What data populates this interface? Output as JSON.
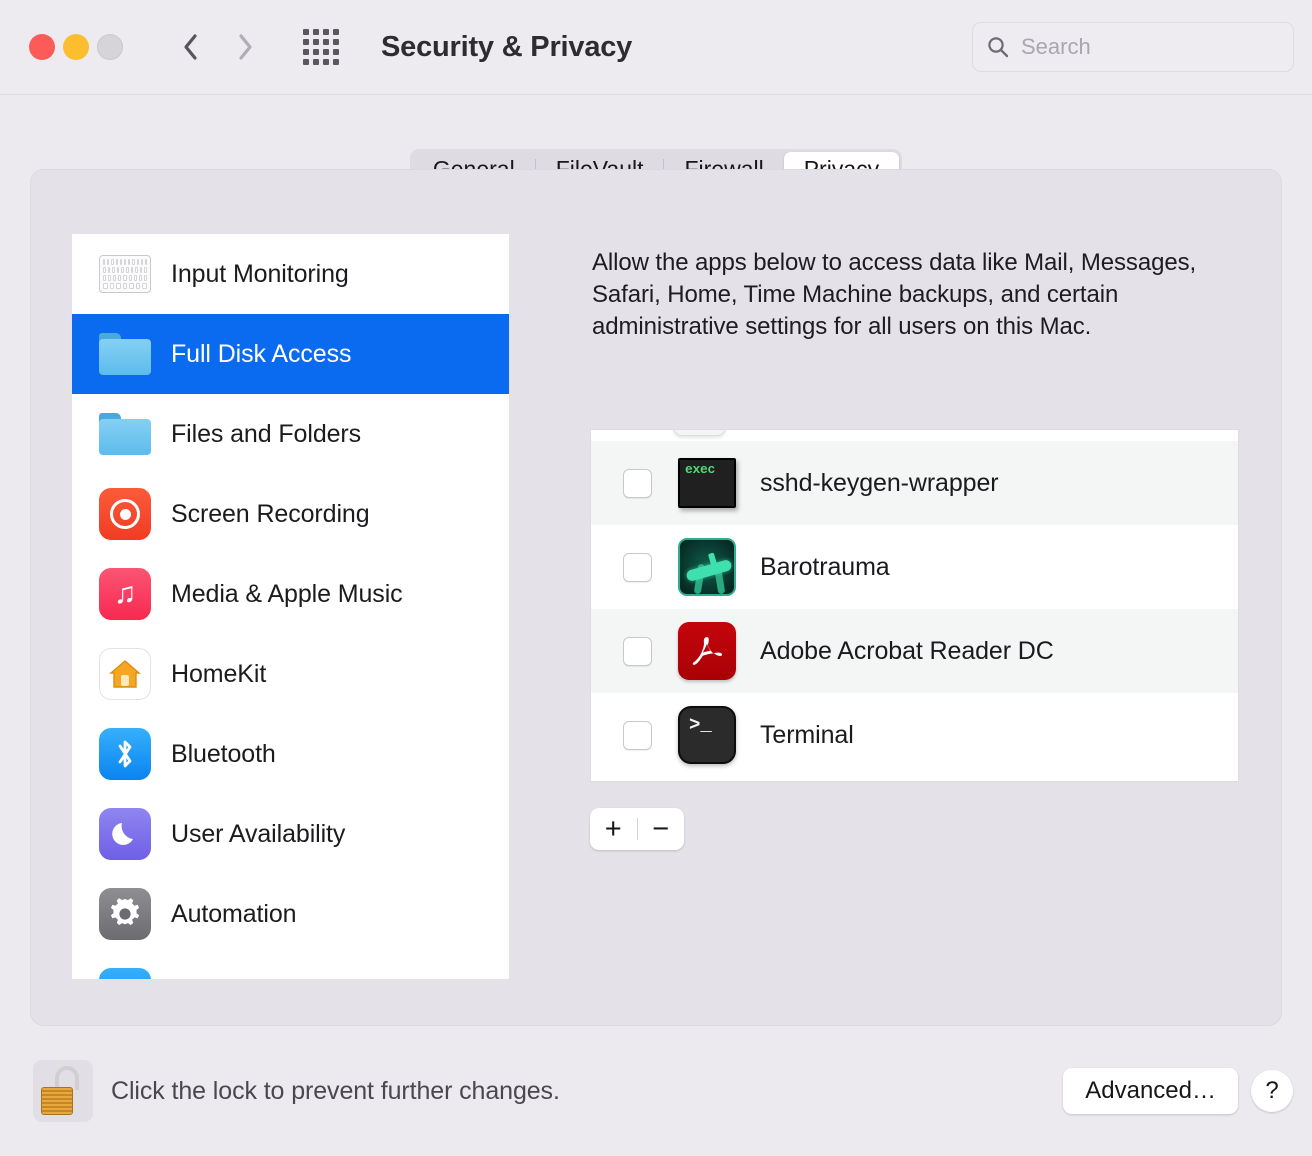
{
  "window": {
    "title": "Security & Privacy",
    "traffic_lights": [
      "close",
      "minimize",
      "zoom"
    ],
    "nav": {
      "back_icon": "chevron-left-icon",
      "forward_icon": "chevron-right-icon",
      "grid_icon": "grid-apps-icon"
    }
  },
  "search": {
    "placeholder": "Search",
    "value": "",
    "icon": "search-icon"
  },
  "tabs": [
    {
      "label": "General",
      "active": false
    },
    {
      "label": "FileVault",
      "active": false
    },
    {
      "label": "Firewall",
      "active": false
    },
    {
      "label": "Privacy",
      "active": true
    }
  ],
  "sidebar": {
    "items": [
      {
        "label": "Input Monitoring",
        "icon": "keyboard-icon",
        "selected": false
      },
      {
        "label": "Full Disk Access",
        "icon": "folder-icon",
        "selected": true
      },
      {
        "label": "Files and Folders",
        "icon": "folder-icon",
        "selected": false
      },
      {
        "label": "Screen Recording",
        "icon": "screen-recording-icon",
        "selected": false
      },
      {
        "label": "Media & Apple Music",
        "icon": "music-note-icon",
        "selected": false
      },
      {
        "label": "HomeKit",
        "icon": "home-icon",
        "selected": false
      },
      {
        "label": "Bluetooth",
        "icon": "bluetooth-icon",
        "selected": false
      },
      {
        "label": "User Availability",
        "icon": "moon-icon",
        "selected": false
      },
      {
        "label": "Automation",
        "icon": "gear-icon",
        "selected": false
      }
    ]
  },
  "pane": {
    "description": "Allow the apps below to access data like Mail, Messages, Safari, Home, Time Machine backups, and certain administrative settings for all users on this Mac.",
    "apps": [
      {
        "name": "sshd-keygen-wrapper",
        "icon": "exec-binary-icon",
        "checked": false
      },
      {
        "name": "Barotrauma",
        "icon": "barotrauma-app-icon",
        "checked": false
      },
      {
        "name": "Adobe Acrobat Reader DC",
        "icon": "adobe-acrobat-icon",
        "checked": false
      },
      {
        "name": "Terminal",
        "icon": "terminal-app-icon",
        "checked": false
      }
    ],
    "add_label": "+",
    "remove_label": "−"
  },
  "footer": {
    "lock_icon": "unlocked-padlock-icon",
    "lock_text": "Click the lock to prevent further changes.",
    "advanced_label": "Advanced…",
    "help_label": "?"
  },
  "colors": {
    "accent_blue": "#0b6bf0",
    "window_bg": "#edebf0",
    "card_bg": "#e4e2e8",
    "list_bg": "#ffffff",
    "row_alt": "#f4f5f5"
  }
}
